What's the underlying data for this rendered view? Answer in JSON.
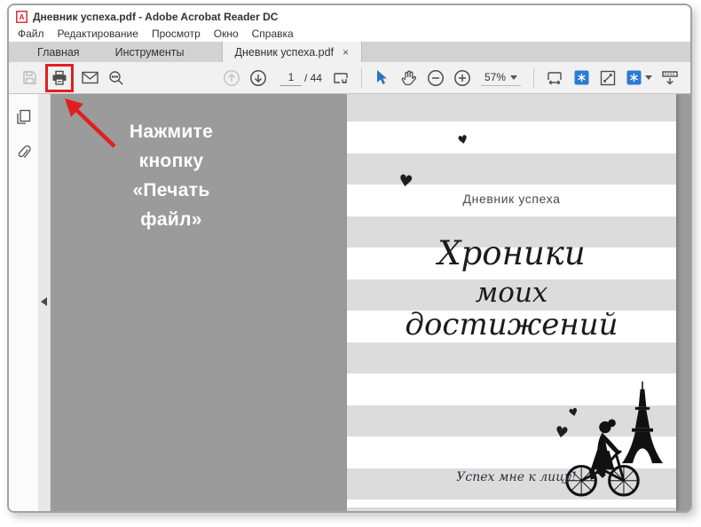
{
  "window": {
    "title": "Дневник успеха.pdf - Adobe Acrobat Reader DC"
  },
  "menu": {
    "items": [
      "Файл",
      "Редактирование",
      "Просмотр",
      "Окно",
      "Справка"
    ]
  },
  "tabs": {
    "home": "Главная",
    "tools": "Инструменты",
    "document": "Дневник успеха.pdf",
    "close_glyph": "×"
  },
  "toolbar": {
    "page_current": "1",
    "page_total": "/ 44",
    "zoom_level": "57%",
    "icons": {
      "save": "save-icon (disabled floppy)",
      "print": "print-icon (highlighted with red frame)",
      "email": "email-icon",
      "search": "search-icon",
      "page-up": "previous-page-icon (disabled)",
      "page-down": "next-page-icon",
      "scroll-mode": "page-scrolling-icon",
      "select": "select-cursor-icon (blue)",
      "hand": "hand-tool-icon",
      "zoom-out": "zoom-out-icon",
      "zoom-in": "zoom-in-icon",
      "fit-width": "fit-width-icon",
      "page-tool-1": "blue-page-tool-icon",
      "fullscreen": "fullscreen-icon",
      "page-tool-2": "blue-page-tool-dropdown-icon",
      "collapse": "collapse-toolbar-icon"
    }
  },
  "sidebar": {
    "icons": {
      "thumbnails": "page-thumbnails-icon",
      "attachments": "paperclip-icon"
    }
  },
  "annotation": {
    "lines": [
      "Нажмите",
      "кнопку",
      "«Печать",
      "файл»"
    ],
    "accent_color": "#e0201f",
    "text_color": "#ffffff"
  },
  "document": {
    "page_title": "Дневник успеха",
    "script_lines": [
      "Хроники",
      "моих",
      "достижений"
    ],
    "caption": "Успех мне к лицу!",
    "hearts": "4 sketched hearts",
    "art": [
      "eiffel-tower-silhouette",
      "girl-on-bicycle-silhouette"
    ]
  },
  "colors": {
    "doc_background": "#9b9b9b",
    "stripe_gray": "#dcdcdc",
    "toolbar_bg": "#f1f1f1",
    "tabbar_bg": "#d2d2d2",
    "accent_blue": "#2b72c0",
    "annotation_red": "#e0201f"
  }
}
